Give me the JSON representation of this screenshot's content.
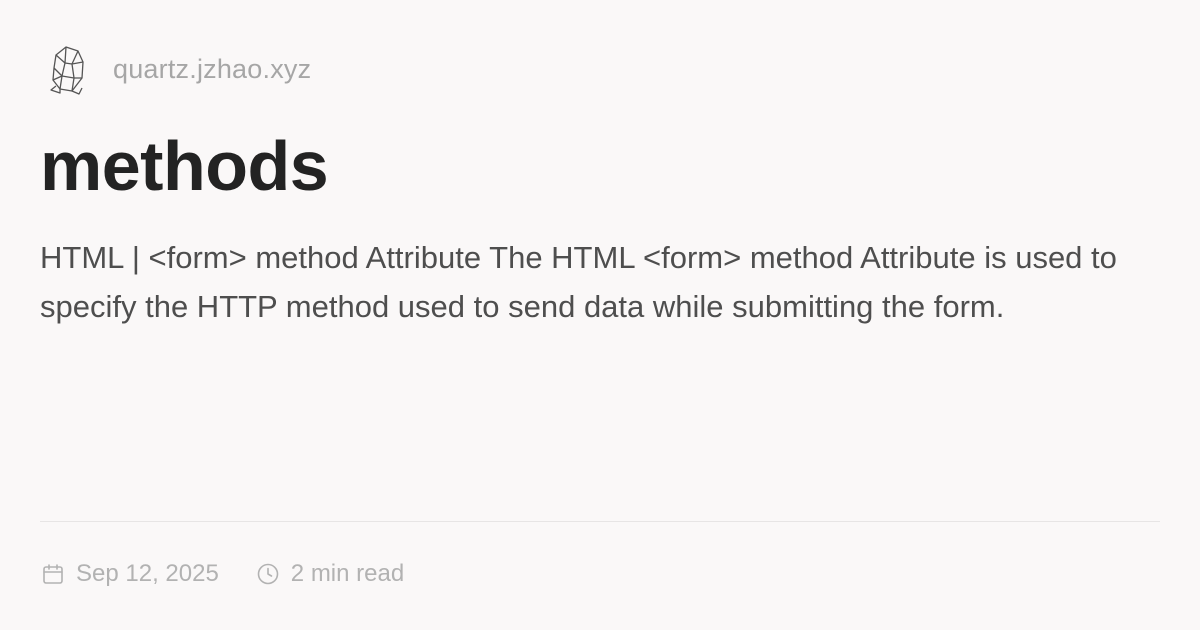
{
  "site": {
    "name": "quartz.jzhao.xyz",
    "logo_icon": "crystal-icon"
  },
  "page": {
    "title": "methods",
    "description": "HTML | <form> method Attribute The HTML <form> method Attribute is used to specify the HTTP method used to send data while submitting the form."
  },
  "meta": {
    "date": "Sep 12, 2025",
    "date_icon": "calendar-icon",
    "reading_time": "2 min read",
    "reading_time_icon": "clock-icon"
  },
  "colors": {
    "background": "#faf8f8",
    "title": "#232323",
    "body_text": "#4e4e4e",
    "muted_text": "#a6a6a6"
  }
}
